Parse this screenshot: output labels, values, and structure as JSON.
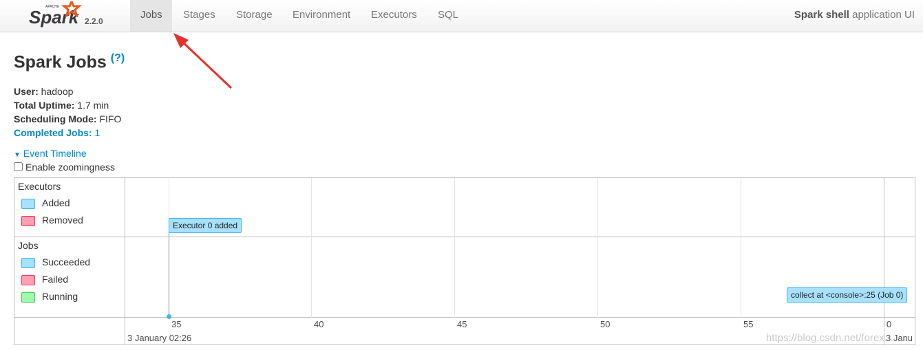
{
  "nav": {
    "logo_text": "Apache Spark",
    "version": "2.2.0",
    "tabs": [
      "Jobs",
      "Stages",
      "Storage",
      "Environment",
      "Executors",
      "SQL"
    ],
    "active_tab": "Jobs",
    "app_bold": "Spark shell",
    "app_rest": " application UI"
  },
  "page": {
    "title": "Spark Jobs",
    "help": "(?)"
  },
  "info": [
    {
      "k": "User:",
      "v": " hadoop"
    },
    {
      "k": "Total Uptime:",
      "v": " 1.7 min"
    },
    {
      "k": "Scheduling Mode:",
      "v": " FIFO"
    },
    {
      "k": "Completed Jobs:",
      "v": " 1"
    }
  ],
  "timeline": {
    "toggle": "Event Timeline",
    "zoom_label": "Enable zoomingness",
    "zoom_checked": false,
    "executors": {
      "title": "Executors",
      "legend": [
        "Added",
        "Removed"
      ]
    },
    "jobs": {
      "title": "Jobs",
      "legend": [
        "Succeeded",
        "Failed",
        "Running"
      ]
    },
    "executor_event": "Executor 0 added",
    "job_event": "collect at <console>:25 (Job 0)",
    "ticks": [
      "35",
      "40",
      "45",
      "50",
      "55",
      "0"
    ],
    "date_left": "3 January 02:26",
    "date_right": "3 Janu",
    "colors": {
      "added": "#a8e1ff",
      "removed": "#ff9fb0",
      "running": "#a0f7b0"
    }
  },
  "watermark": "https://blog.csdn.net/forex..."
}
